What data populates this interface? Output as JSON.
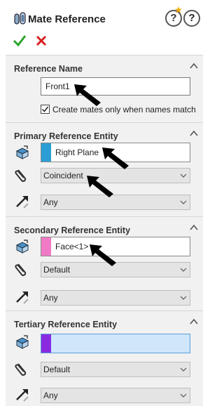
{
  "header": {
    "title": "Mate Reference",
    "help_label": "?",
    "help2_label": "?"
  },
  "reference_name": {
    "title": "Reference Name",
    "value": "Front1",
    "checkbox_checked": true,
    "checkbox_label": "Create mates only when names match"
  },
  "primary": {
    "title": "Primary Reference Entity",
    "entity": "Right Plane",
    "swatch_color": "#2a9ed4",
    "mate_type": "Coincident",
    "alignment": "Any"
  },
  "secondary": {
    "title": "Secondary Reference Entity",
    "entity": "Face<1>",
    "swatch_color": "#f07ac6",
    "mate_type": "Default",
    "alignment": "Any"
  },
  "tertiary": {
    "title": "Tertiary Reference Entity",
    "entity": "",
    "swatch_color": "#8a2be2",
    "mate_type": "Default",
    "alignment": "Any"
  },
  "colors": {
    "ok_green": "#2aa52a",
    "cancel_red": "#d81f1f",
    "section_bg": "#f1f1f1",
    "active_field": "#cfe6fb"
  }
}
